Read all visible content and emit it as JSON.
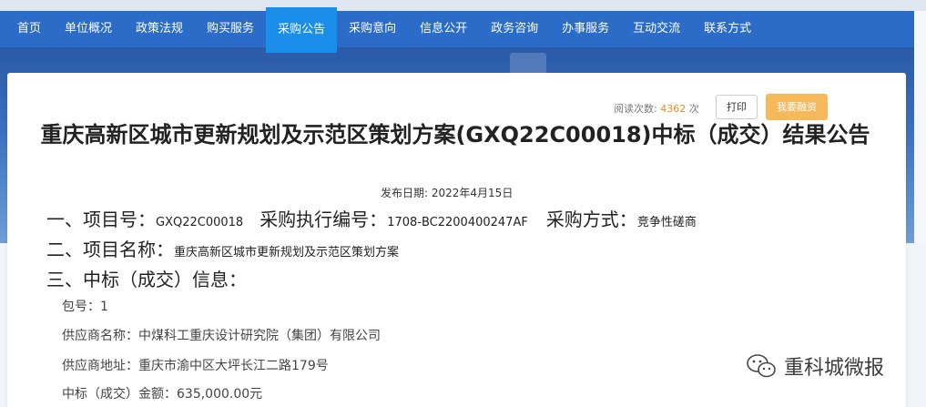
{
  "nav": {
    "items": [
      "首页",
      "单位概况",
      "政策法规",
      "购买服务",
      "采购公告",
      "采购意向",
      "信息公开",
      "政务咨询",
      "办事服务",
      "互动交流",
      "联系方式"
    ],
    "active_index": 4
  },
  "toolbar": {
    "read_label": "阅读次数:",
    "read_count": "4362",
    "read_unit": "次",
    "print_label": "打印",
    "help_label": "我要融资"
  },
  "article": {
    "title": "重庆高新区城市更新规划及示范区策划方案(GXQ22C00018)中标（成交）结果公告",
    "pub_label": "发布日期:",
    "pub_date": "2022年4月15日",
    "project_no_label": "一、项目号：",
    "project_no": "GXQ22C00018",
    "exec_no_label": "采购执行编号：",
    "exec_no": "1708-BC2200400247AF",
    "method_label": "采购方式：",
    "method": "竞争性磋商",
    "name_label": "二、项目名称：",
    "name": "重庆高新区城市更新规划及示范区策划方案",
    "info_label": "三、中标（成交）信息：",
    "details": [
      {
        "label": "包号：",
        "value": "1"
      },
      {
        "label": "供应商名称：",
        "value": "中煤科工重庆设计研究院（集团）有限公司"
      },
      {
        "label": "供应商地址：",
        "value": "重庆市渝中区大坪长江二路179号"
      },
      {
        "label": "中标（成交）金额：",
        "value": "635,000.00元"
      }
    ]
  },
  "watermark": {
    "text": "重科城微报",
    "icon": "wechat-icon"
  },
  "colors": {
    "nav_bg": "#2b6cc8",
    "nav_active": "#1a8ee8",
    "accent_orange": "#f5b85a",
    "count_color": "#e88b1a"
  }
}
